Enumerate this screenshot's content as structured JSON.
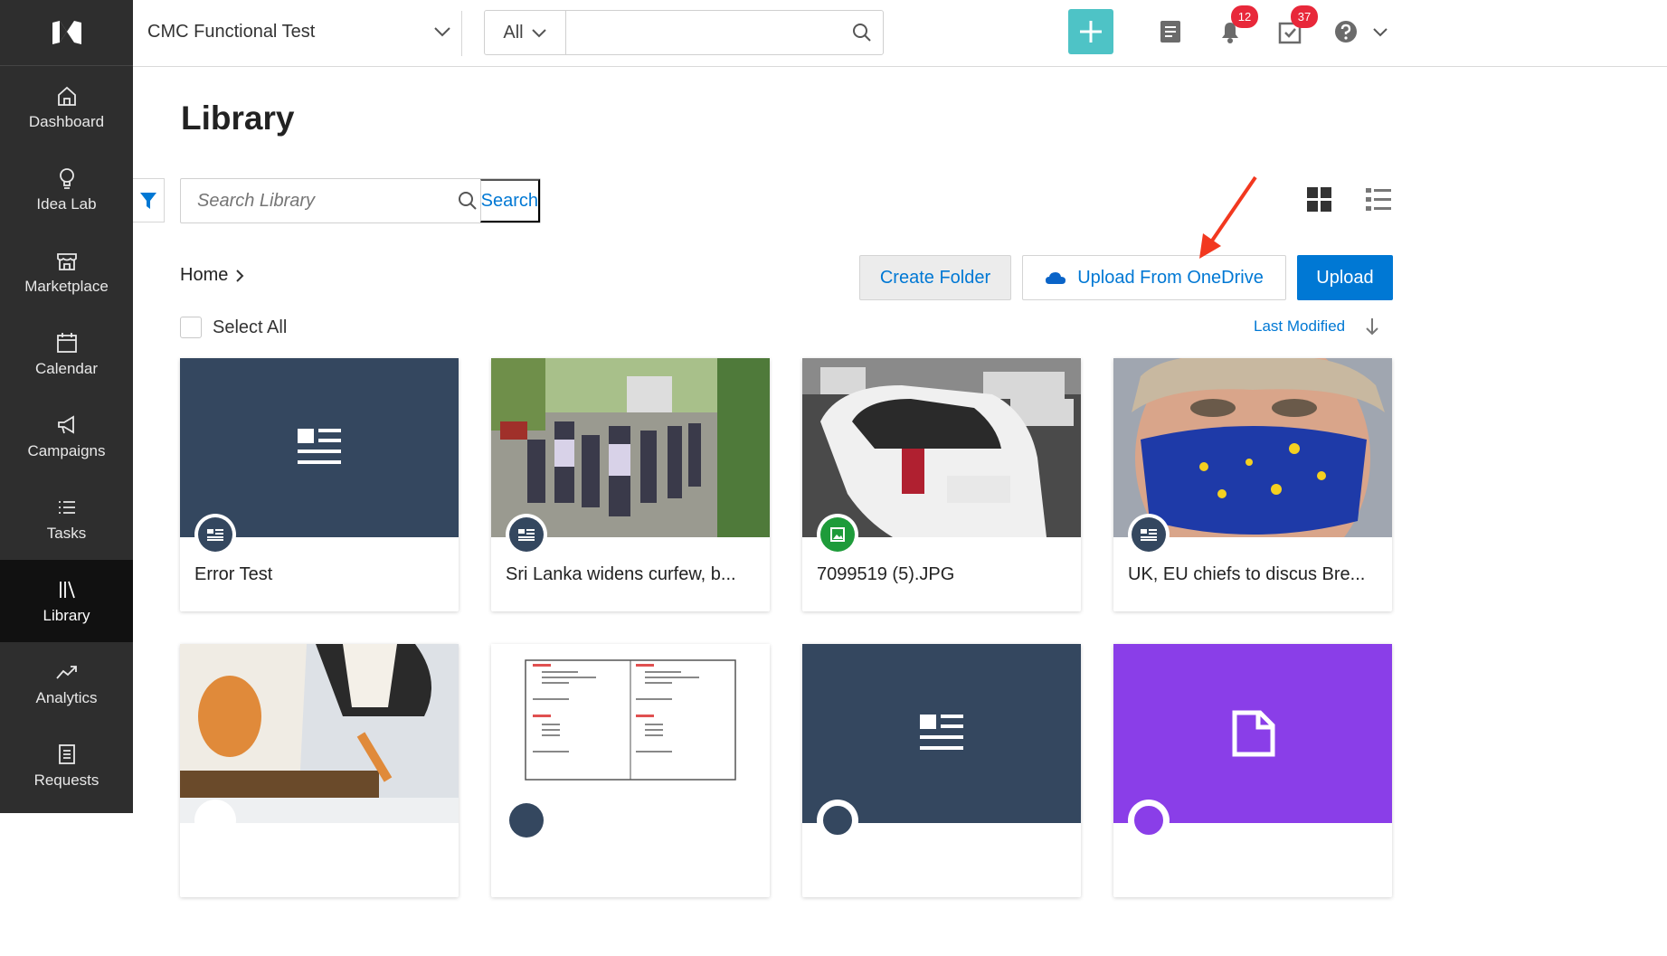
{
  "sidebar": {
    "items": [
      {
        "label": "Dashboard",
        "icon": "home-icon"
      },
      {
        "label": "Idea Lab",
        "icon": "lightbulb-icon"
      },
      {
        "label": "Marketplace",
        "icon": "store-icon"
      },
      {
        "label": "Calendar",
        "icon": "calendar-icon"
      },
      {
        "label": "Campaigns",
        "icon": "megaphone-icon"
      },
      {
        "label": "Tasks",
        "icon": "list-icon"
      },
      {
        "label": "Library",
        "icon": "books-icon",
        "active": true
      },
      {
        "label": "Analytics",
        "icon": "trend-icon"
      },
      {
        "label": "Requests",
        "icon": "document-icon"
      }
    ]
  },
  "topbar": {
    "workspace": "CMC Functional Test",
    "scope": "All",
    "search_value": "",
    "notifications_count": "12",
    "tasks_count": "37",
    "accent": "#4ec3c6"
  },
  "library": {
    "title": "Library",
    "search_placeholder": "Search Library",
    "search_button": "Search",
    "breadcrumb_home": "Home",
    "create_folder": "Create Folder",
    "upload_onedrive": "Upload From OneDrive",
    "upload": "Upload",
    "select_all": "Select All",
    "sort_label": "Last Modified",
    "accent": "#0078d4"
  },
  "cards": [
    {
      "title": "Error Test",
      "type": "article"
    },
    {
      "title": "Sri Lanka widens curfew, b...",
      "type": "article"
    },
    {
      "title": "7099519 (5).JPG",
      "type": "image"
    },
    {
      "title": "UK, EU chiefs to discus Bre...",
      "type": "article"
    },
    {
      "title": "",
      "type": "image"
    },
    {
      "title": "",
      "type": "document"
    },
    {
      "title": "",
      "type": "article"
    },
    {
      "title": "",
      "type": "file"
    }
  ]
}
